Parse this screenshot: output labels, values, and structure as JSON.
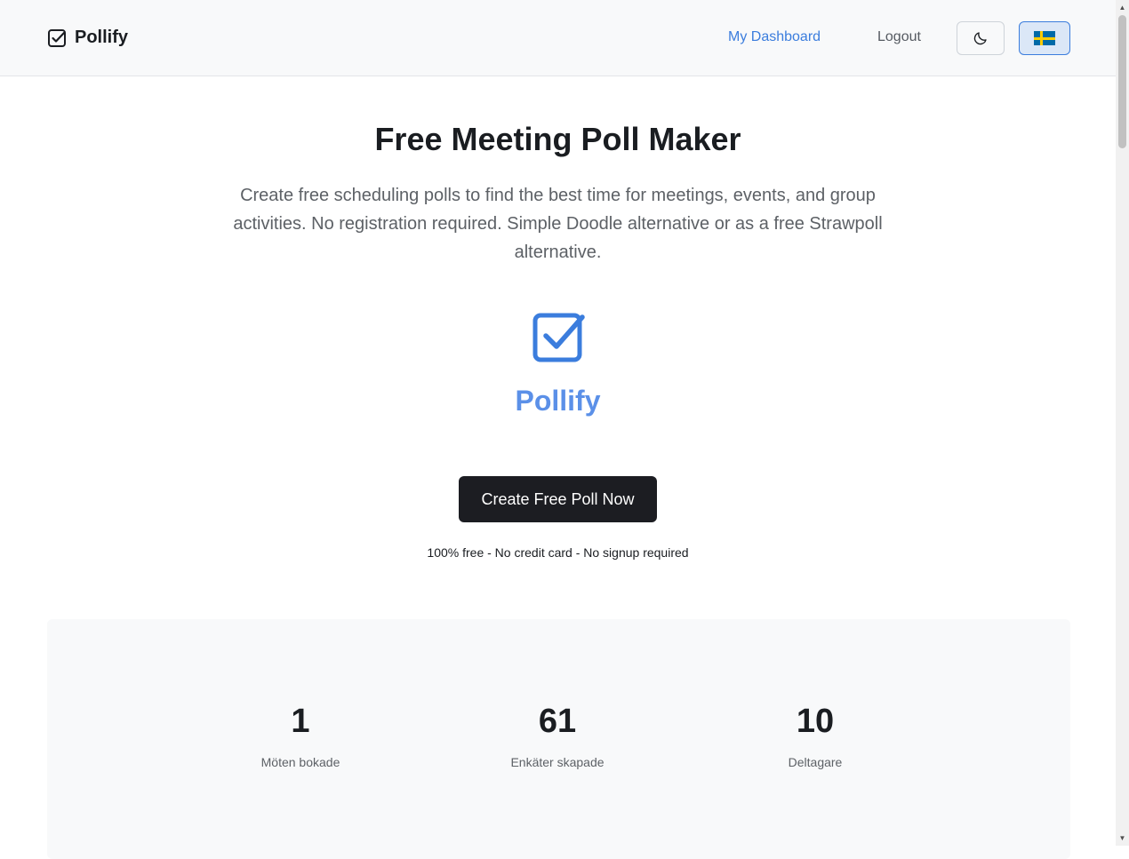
{
  "header": {
    "brand_name": "Pollify",
    "nav": {
      "dashboard": "My Dashboard",
      "logout": "Logout"
    },
    "theme_icon": "moon-icon",
    "language_flag": "sweden-flag-icon"
  },
  "hero": {
    "title": "Free Meeting Poll Maker",
    "description": "Create free scheduling polls to find the best time for meetings, events, and group activities. No registration required. Simple Doodle alternative or as a free Strawpoll alternative.",
    "logo_text": "Pollify",
    "cta_label": "Create Free Poll Now",
    "cta_note": "100% free - No credit card - No signup required"
  },
  "stats": [
    {
      "value": "1",
      "label": "Möten bokade"
    },
    {
      "value": "61",
      "label": "Enkäter skapade"
    },
    {
      "value": "10",
      "label": "Deltagare"
    }
  ],
  "colors": {
    "accent": "#3b7ddd",
    "logo": "#5b90e8",
    "cta_bg": "#1c1d22",
    "header_bg": "#f8f9fa"
  }
}
